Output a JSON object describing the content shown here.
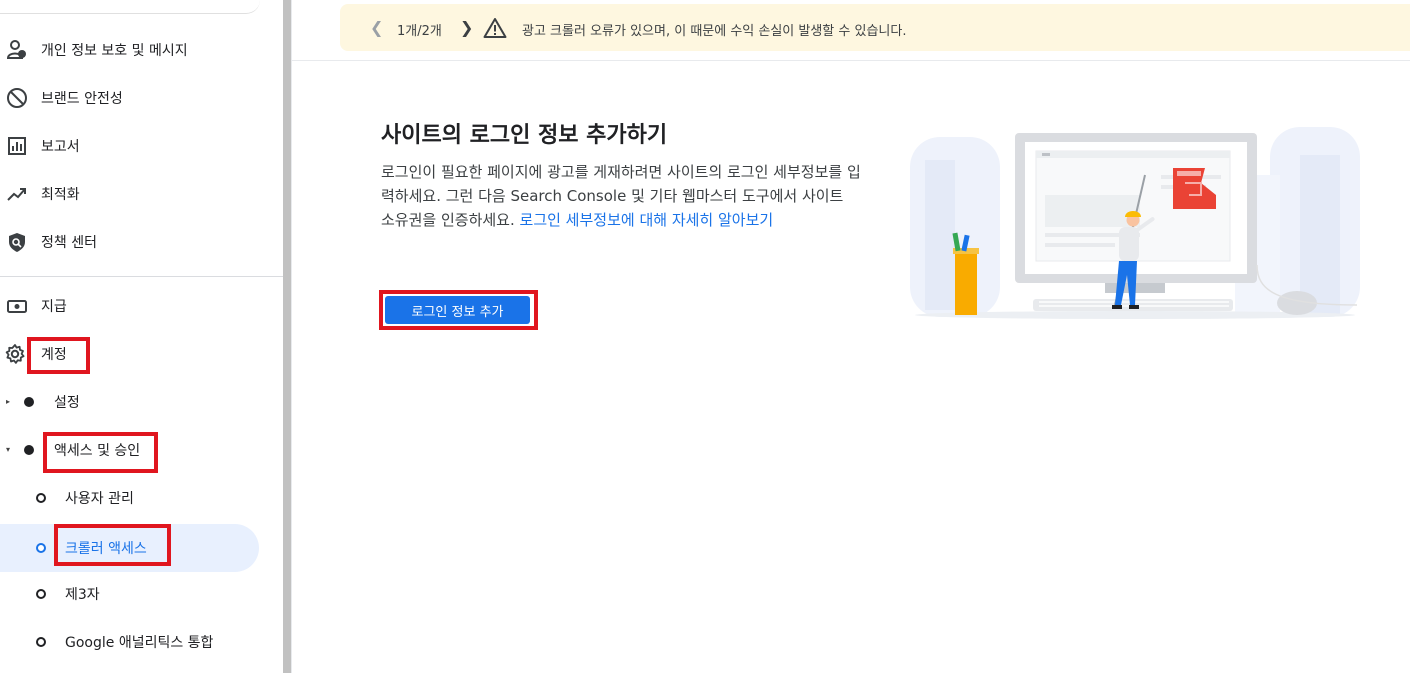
{
  "sidebar": {
    "items": [
      {
        "label": "개인 정보 보호 및 메시지",
        "icon": "privacy-person-icon"
      },
      {
        "label": "브랜드 안전성",
        "icon": "block-icon"
      },
      {
        "label": "보고서",
        "icon": "report-chart-icon"
      },
      {
        "label": "최적화",
        "icon": "trending-up-icon"
      },
      {
        "label": "정책 센터",
        "icon": "policy-shield-icon"
      },
      {
        "label": "지급",
        "icon": "payments-icon"
      },
      {
        "label": "계정",
        "icon": "gear-icon"
      }
    ],
    "account_children": [
      {
        "label": "설정",
        "expanded": false
      },
      {
        "label": "액세스 및 승인",
        "expanded": true
      }
    ],
    "access_children": [
      {
        "label": "사용자 관리"
      },
      {
        "label": "크롤러 액세스",
        "active": true
      },
      {
        "label": "제3자"
      },
      {
        "label": "Google 애널리틱스 통합"
      }
    ]
  },
  "banner": {
    "count": "1개/2개",
    "message": "광고 크롤러 오류가 있으며, 이 때문에 수익 손실이 발생할 수 있습니다."
  },
  "main": {
    "title": "사이트의 로그인 정보 추가하기",
    "description": "로그인이 필요한 페이지에 광고를 게재하려면 사이트의 로그인 세부정보를 입력하세요. 그런 다음 Search Console 및 기타 웹마스터 도구에서 사이트 소유권을 인증하세요. ",
    "learn_more_link": "로그인 세부정보에 대해 자세히 알아보기",
    "add_button": "로그인 정보 추가"
  },
  "colors": {
    "accent": "#1a73e8",
    "active_bg": "#e8f0fe",
    "banner_bg": "#fef7e0",
    "highlight_red": "#e0161f"
  }
}
